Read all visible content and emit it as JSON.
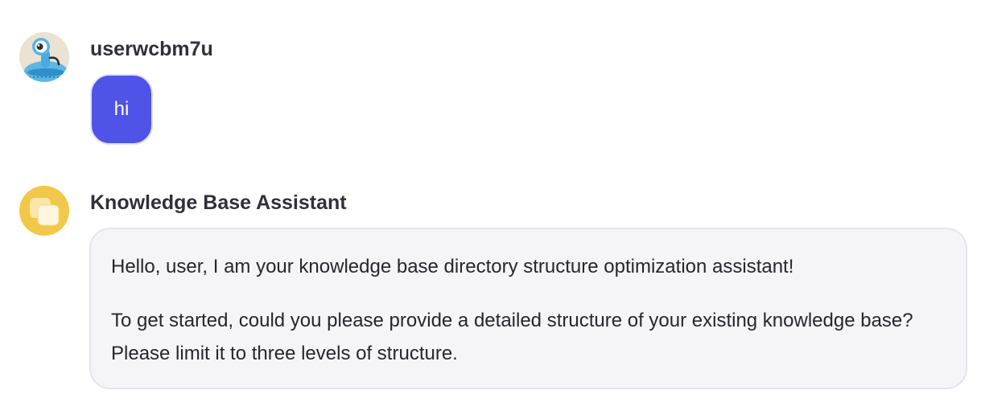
{
  "conversation": {
    "messages": [
      {
        "role": "user",
        "sender": "userwcbm7u",
        "avatar_icon": "robot-alien-avatar-icon",
        "text": "hi"
      },
      {
        "role": "assistant",
        "sender": "Knowledge Base Assistant",
        "avatar_icon": "stacked-squares-avatar-icon",
        "paragraphs": [
          "Hello, user, I am your knowledge base directory structure optimization assistant!",
          "To get started, could you please provide a detailed structure of your existing knowledge base? Please limit it to three levels of structure."
        ]
      }
    ]
  },
  "colors": {
    "user_bubble": "#4f53e8",
    "assistant_bubble": "#f5f5f8",
    "assistant_avatar": "#f1c84a",
    "user_avatar_bg": "#ebe2d2"
  }
}
